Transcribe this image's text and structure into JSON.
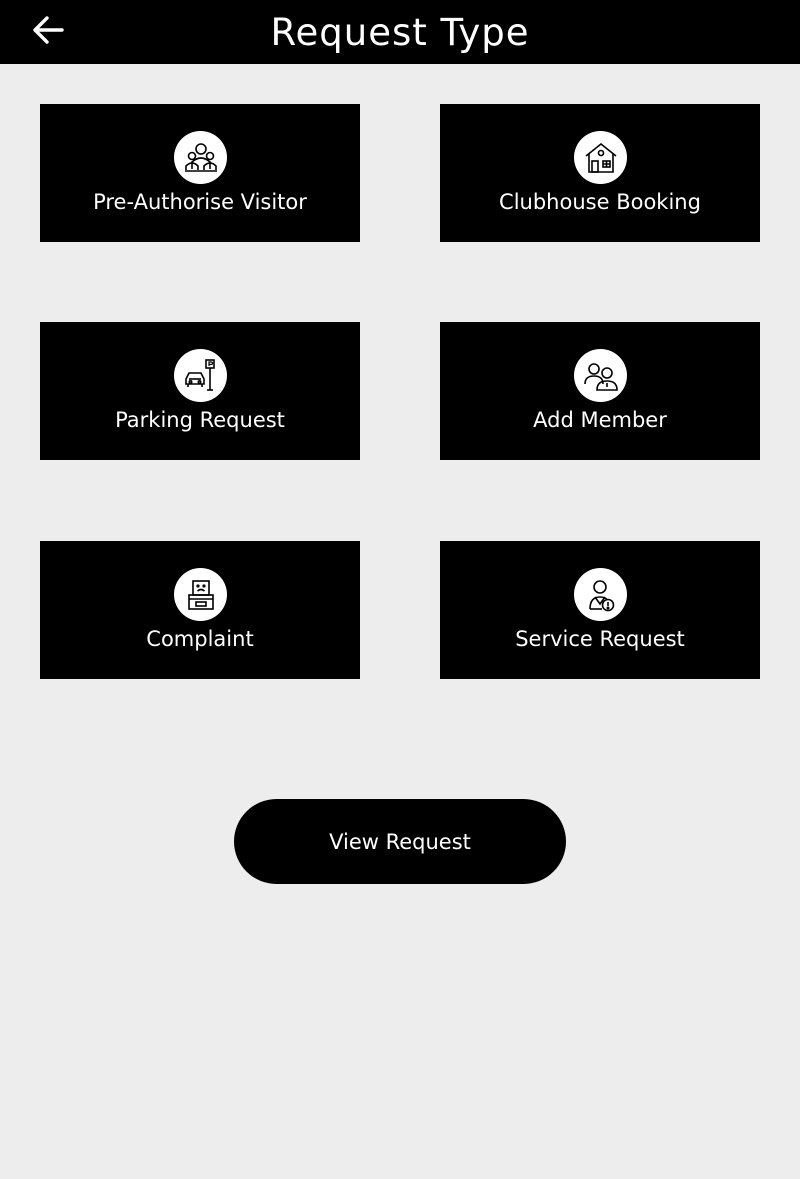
{
  "header": {
    "title": "Request Type",
    "back_icon": "arrow-left-icon"
  },
  "tiles": [
    {
      "label": "Pre-Authorise Visitor",
      "icon": "visitors-icon"
    },
    {
      "label": "Clubhouse Booking",
      "icon": "clubhouse-icon"
    },
    {
      "label": "Parking Request",
      "icon": "parking-icon"
    },
    {
      "label": "Add Member",
      "icon": "add-member-icon"
    },
    {
      "label": "Complaint",
      "icon": "complaint-icon"
    },
    {
      "label": "Service Request",
      "icon": "service-request-icon"
    }
  ],
  "footer": {
    "view_request_label": "View Request"
  },
  "colors": {
    "background": "#ededed",
    "tile": "#000000",
    "text": "#ffffff"
  }
}
